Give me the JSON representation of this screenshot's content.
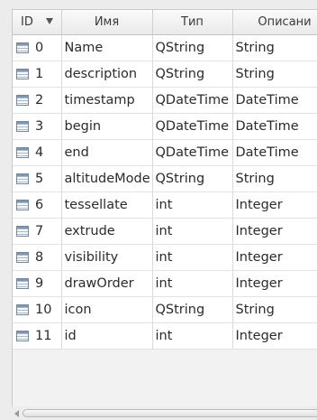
{
  "table": {
    "columns": [
      {
        "label": "ID",
        "sort": "descending"
      },
      {
        "label": "Имя"
      },
      {
        "label": "Тип"
      },
      {
        "label": "Описани"
      }
    ],
    "rows": [
      {
        "id": "0",
        "name": "Name",
        "type": "QString",
        "description": "String"
      },
      {
        "id": "1",
        "name": "description",
        "type": "QString",
        "description": "String"
      },
      {
        "id": "2",
        "name": "timestamp",
        "type": "QDateTime",
        "description": "DateTime"
      },
      {
        "id": "3",
        "name": "begin",
        "type": "QDateTime",
        "description": "DateTime"
      },
      {
        "id": "4",
        "name": "end",
        "type": "QDateTime",
        "description": "DateTime"
      },
      {
        "id": "5",
        "name": "altitudeMode",
        "type": "QString",
        "description": "String"
      },
      {
        "id": "6",
        "name": "tessellate",
        "type": "int",
        "description": "Integer"
      },
      {
        "id": "7",
        "name": "extrude",
        "type": "int",
        "description": "Integer"
      },
      {
        "id": "8",
        "name": "visibility",
        "type": "int",
        "description": "Integer"
      },
      {
        "id": "9",
        "name": "drawOrder",
        "type": "int",
        "description": "Integer"
      },
      {
        "id": "10",
        "name": "icon",
        "type": "QString",
        "description": "String"
      },
      {
        "id": "11",
        "name": "id",
        "type": "int",
        "description": "Integer"
      }
    ],
    "row_icon": "table-row-icon"
  }
}
